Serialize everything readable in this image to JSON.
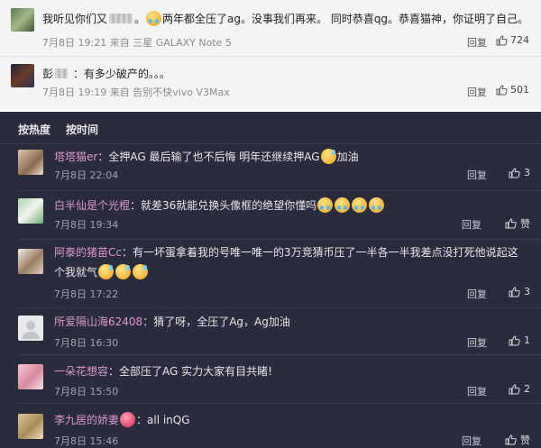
{
  "top_comments": [
    {
      "text_before_blur": "我听见你们又",
      "text_mid": "。",
      "text_after_emoji": "两年都全压了ag。没事我们再来。 同时恭喜qg。恭喜猫神，你证明了自己。",
      "date": "7月8日 19:21",
      "source": "来自 三星 GALAXY Note 5",
      "reply": "回复",
      "likes": "724"
    },
    {
      "user": "彭",
      "text": "：有多少破产的。。。",
      "date": "7月8日 19:19",
      "source": "来自 告别不快vivo V3Max",
      "reply": "回复",
      "likes": "501"
    }
  ],
  "tabs": [
    {
      "label": "按热度"
    },
    {
      "label": "按时间"
    }
  ],
  "comments": [
    {
      "user": "塔塔猫er",
      "text": "：全押AG 最后输了也不后悔 明年还继续押AG",
      "tail": "加油",
      "date": "7月8日 22:04",
      "reply": "回复",
      "likes": "3"
    },
    {
      "user": "白半仙是个光棍",
      "text": "：就差36就能兑换头像框的绝望你懂吗",
      "date": "7月8日 19:34",
      "reply": "回复",
      "likes": "赞"
    },
    {
      "user": "阿泰的猪苗Cc",
      "text": "：有一坏蛋拿着我的号唯一唯一的3万竞猜币压了一半各一半我差点没打死他说起这",
      "text2": "个我就气",
      "date": "7月8日 17:22",
      "reply": "回复",
      "likes": "3"
    },
    {
      "user": "所爱隔山海62408",
      "text": "：猜了呀，全压了Ag，Ag加油",
      "date": "7月8日 16:30",
      "reply": "回复",
      "likes": "1"
    },
    {
      "user": "一朵花想容",
      "text": "：全部压了AG 实力大家有目共睹!",
      "date": "7月8日 15:50",
      "reply": "回复",
      "likes": "2"
    },
    {
      "user": "李九居的娇妻",
      "text": "：all inQG",
      "date": "7月8日 15:46",
      "reply": "回复",
      "likes": "赞"
    }
  ],
  "colors": {
    "dark_bg": "#2a2c3b",
    "light_bg": "#f4f4f4",
    "username": "#d99acb"
  },
  "icons": [
    "thumb-up-icon",
    "crying-emoji-icon",
    "sweat-emoji-icon",
    "heart-emoji-icon"
  ]
}
